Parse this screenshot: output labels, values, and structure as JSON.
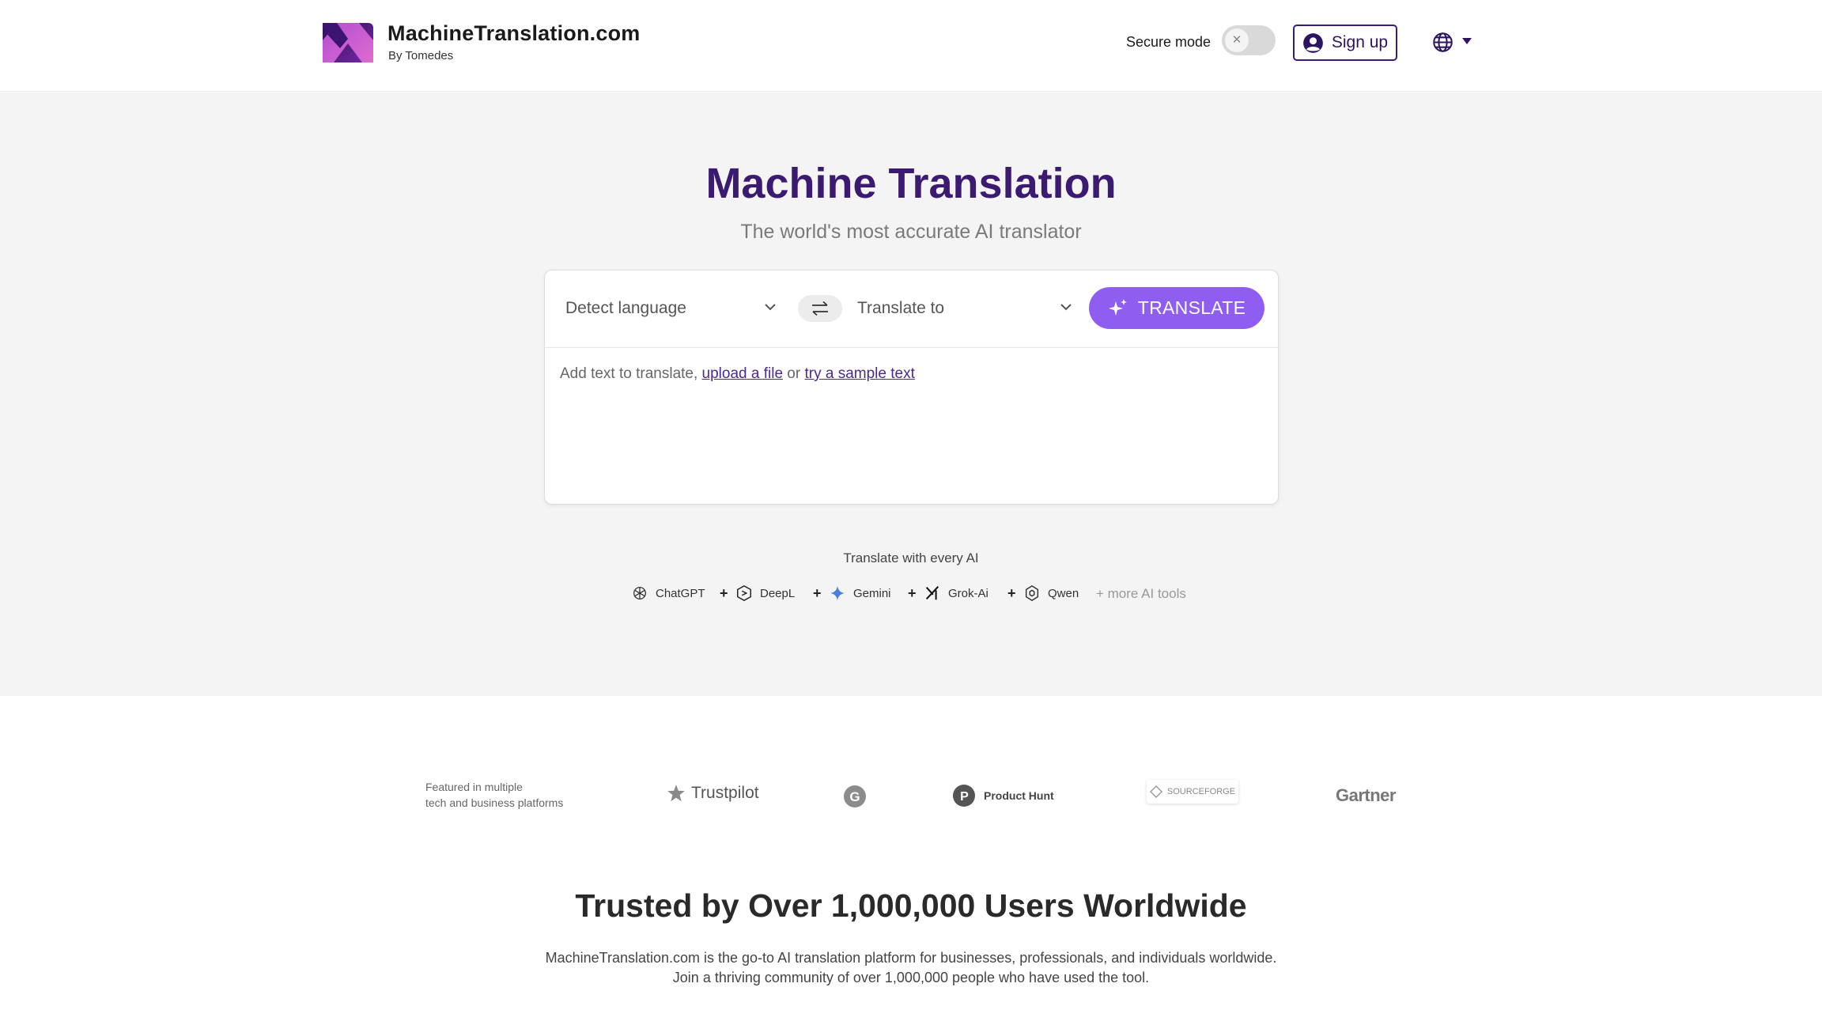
{
  "header": {
    "brand_name": "MachineTranslation.com",
    "brand_sub": "By Tomedes",
    "secure_mode_label": "Secure mode",
    "secure_mode_on": false,
    "signup_label": "Sign up",
    "icons": [
      "logo-icon",
      "user-circle-icon",
      "globe-icon",
      "caret-down-icon"
    ]
  },
  "hero": {
    "title": "Machine Translation",
    "subtitle": "The world's most accurate AI translator"
  },
  "translator": {
    "source_lang": "Detect language",
    "target_lang": "Translate to",
    "translate_label": "TRANSLATE",
    "placeholder_prefix": "Add text to translate,",
    "upload_link": "upload a file",
    "or_text": "or",
    "sample_link": "try a sample text"
  },
  "ai_tools": {
    "label": "Translate with every AI",
    "items": [
      {
        "name": "ChatGPT",
        "icon": "chatgpt-icon"
      },
      {
        "name": "DeepL",
        "icon": "deepl-icon"
      },
      {
        "name": "Gemini",
        "icon": "gemini-icon"
      },
      {
        "name": "Grok-Ai",
        "icon": "grok-icon"
      },
      {
        "name": "Qwen",
        "icon": "qwen-icon"
      }
    ],
    "plus": "+",
    "more": "+ more AI tools"
  },
  "featured": {
    "label_line1": "Featured in multiple",
    "label_line2": "tech and business platforms",
    "platforms": {
      "trustpilot": "Trustpilot",
      "g2": "G",
      "producthunt": "Product Hunt",
      "producthunt_letter": "P",
      "sourceforge": "SOURCEFORGE",
      "gartner": "Gartner"
    }
  },
  "trusted": {
    "title": "Trusted by Over 1,000,000 Users Worldwide",
    "line1": "MachineTranslation.com is the go-to AI translation platform for businesses, professionals, and individuals worldwide.",
    "line2": "Join a thriving community of over 1,000,000 people who have used the tool."
  },
  "colors": {
    "brand_purple": "#3d1a72",
    "button_purple": "#8f5ef0",
    "hero_bg": "#f4f4f4"
  }
}
